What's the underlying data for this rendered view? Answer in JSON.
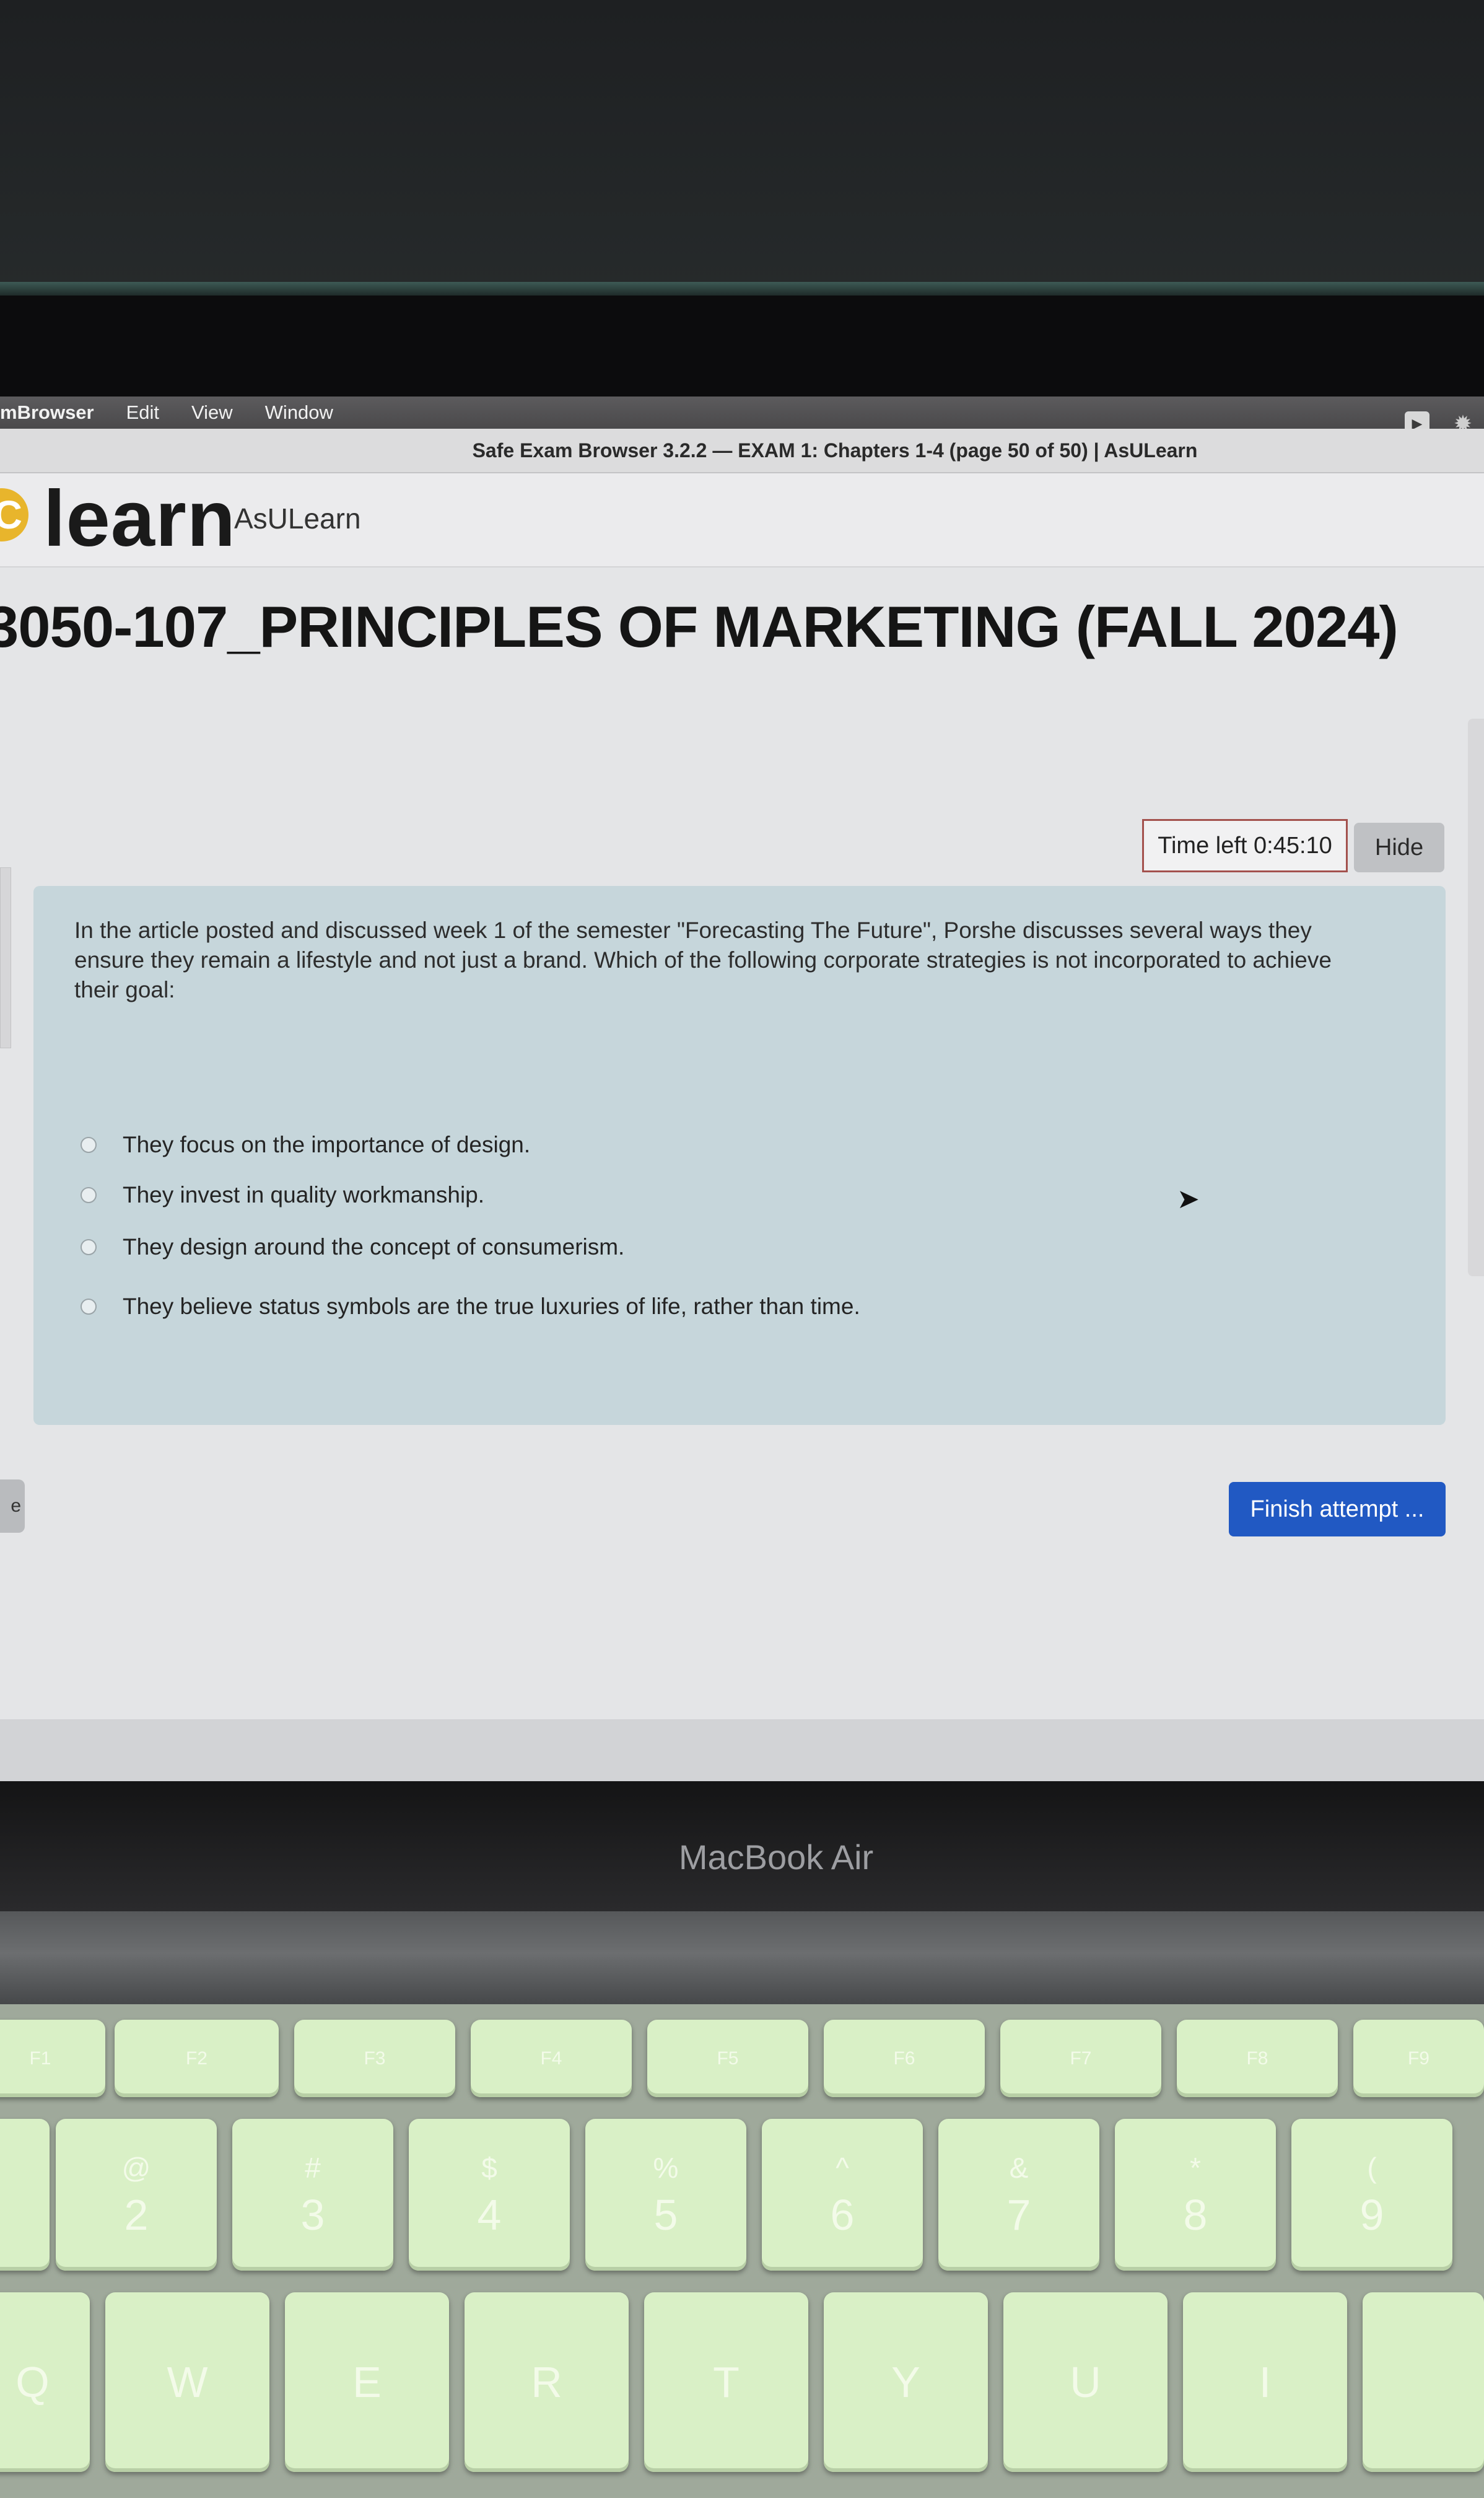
{
  "menubar": {
    "items": [
      "mBrowser",
      "Edit",
      "View",
      "Window"
    ]
  },
  "window": {
    "title": "Safe Exam Browser 3.2.2 — EXAM 1: Chapters 1-4 (page 50 of 50) | AsULearn"
  },
  "header": {
    "logo_mark": "C",
    "logo_text": "learn",
    "site_name": "AsULearn"
  },
  "course": {
    "title": "3050-107_PRINCIPLES OF MARKETING (FALL 2024)"
  },
  "timer": {
    "label": "Time left 0:45:10",
    "hide_label": "Hide"
  },
  "question": {
    "text": "In the article posted and discussed week 1 of the semester \"Forecasting The Future\", Porshe discusses several ways they ensure they remain a lifestyle and not just a brand. Which of the following corporate strategies is not incorporated to achieve their goal:",
    "options": [
      "They focus on the importance of design.",
      "They invest in quality workmanship.",
      "They design around the concept of consumerism.",
      "They believe status symbols are the true luxuries of life, rather than time."
    ]
  },
  "navigation": {
    "previous_stub": "e",
    "finish_label": "Finish attempt ..."
  },
  "device": {
    "label": "MacBook Air"
  },
  "keyboard": {
    "number_row": [
      {
        "sym": "@",
        "digit": "2"
      },
      {
        "sym": "#",
        "digit": "3"
      },
      {
        "sym": "$",
        "digit": "4"
      },
      {
        "sym": "%",
        "digit": "5"
      },
      {
        "sym": "^",
        "digit": "6"
      },
      {
        "sym": "&",
        "digit": "7"
      },
      {
        "sym": "*",
        "digit": "8"
      },
      {
        "sym": "(",
        "digit": "9"
      }
    ],
    "letter_row": [
      "Q",
      "W",
      "E",
      "R",
      "T",
      "Y",
      "U",
      "I"
    ],
    "fkeys": [
      "F1",
      "F2",
      "F3",
      "F4",
      "F5",
      "F6",
      "F7",
      "F8",
      "F9"
    ]
  }
}
